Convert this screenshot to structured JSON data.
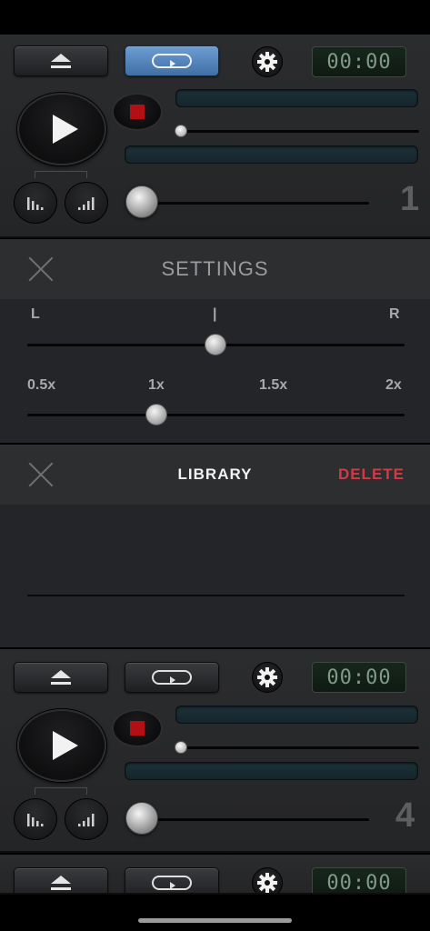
{
  "decks": [
    {
      "id": "1",
      "time": "00:00",
      "loop_active": true,
      "number": "1"
    },
    {
      "id": "4",
      "time": "00:00",
      "loop_active": false,
      "number": "4"
    },
    {
      "id": "5",
      "time": "00:00",
      "loop_active": false
    }
  ],
  "settings": {
    "title": "SETTINGS",
    "pan": {
      "left_label": "L",
      "center_label": "|",
      "right_label": "R",
      "value": 0.5
    },
    "speed": {
      "labels": [
        "0.5x",
        "1x",
        "1.5x",
        "2x"
      ],
      "value": "1x"
    }
  },
  "library": {
    "title": "LIBRARY",
    "delete_label": "DELETE"
  },
  "icons": {
    "eject": "eject-icon",
    "loop": "loop-icon",
    "settings": "gear-icon",
    "play": "play-icon",
    "record": "record-icon",
    "eq_low": "eq-low-icon",
    "eq_high": "eq-high-icon",
    "close": "close-icon"
  },
  "colors": {
    "accent_loop": "#5a8ac0",
    "record": "#b30f14",
    "delete": "#d33a45",
    "timer_text": "#7f9b88"
  }
}
